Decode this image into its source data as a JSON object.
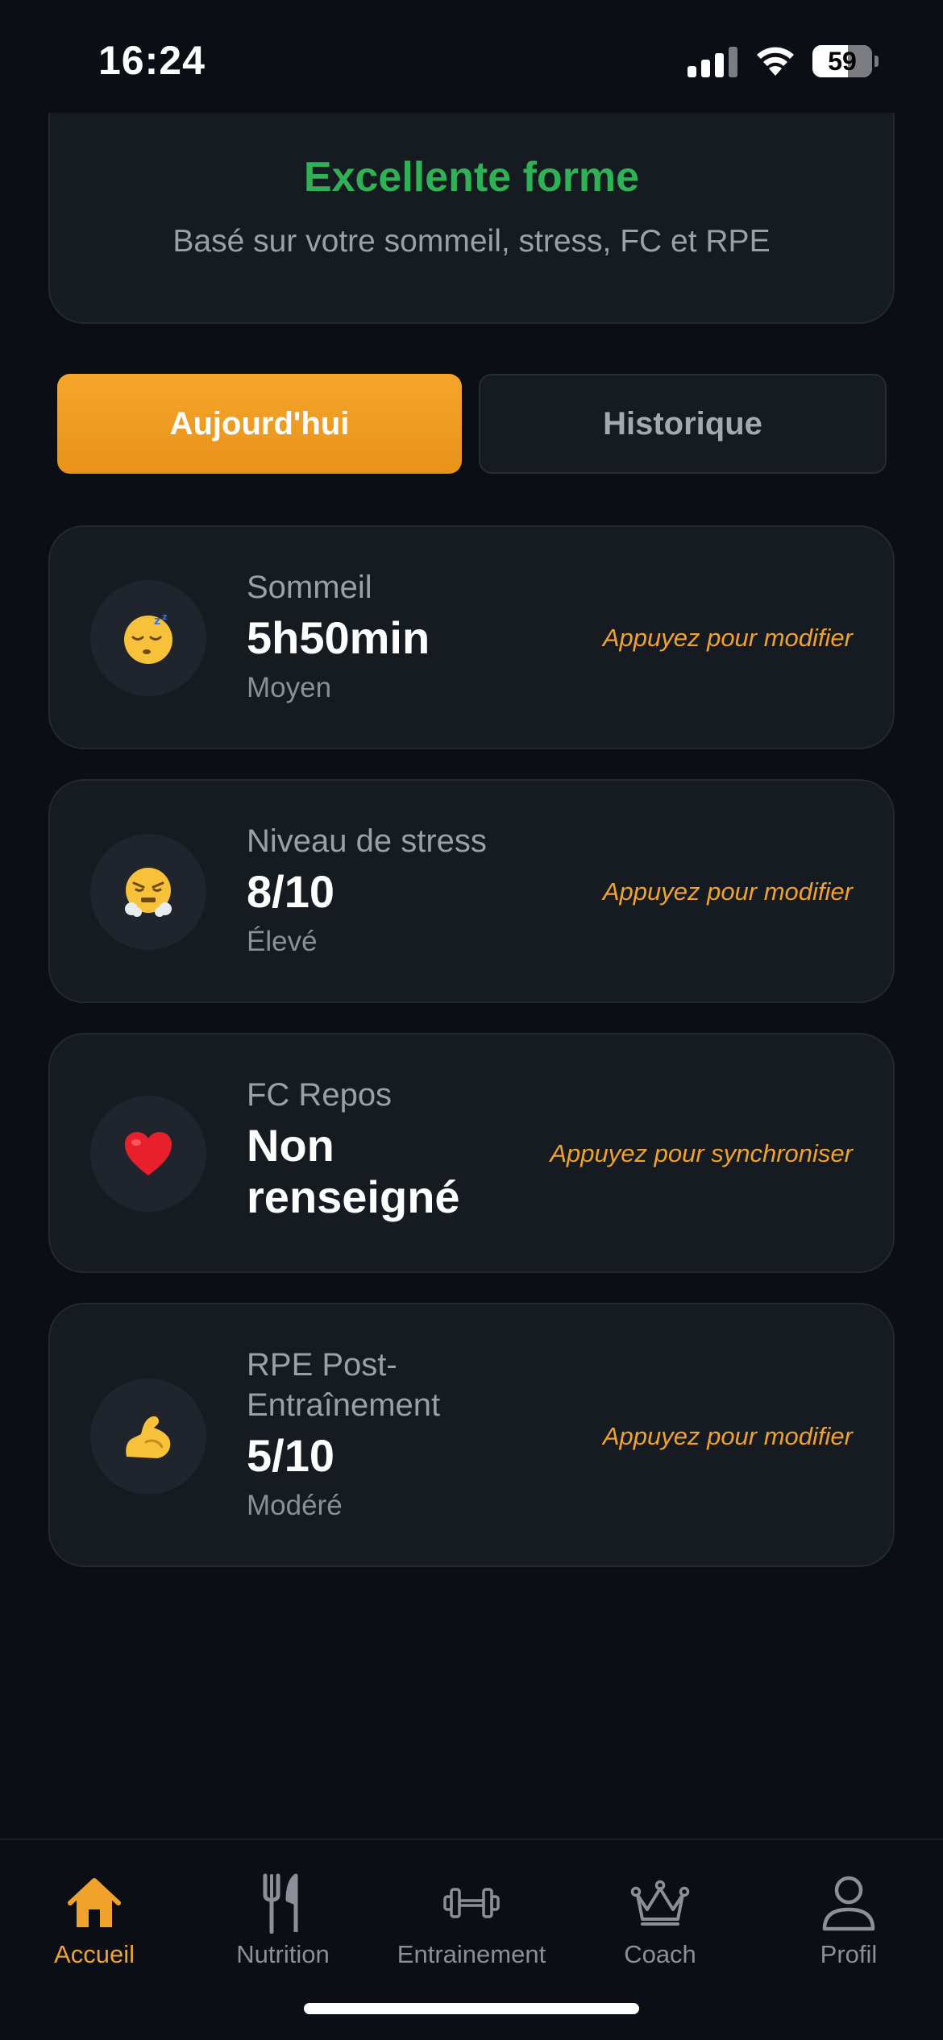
{
  "status_bar": {
    "time": "16:24",
    "battery": "59"
  },
  "readiness": {
    "title": "Excellente forme",
    "subtitle": "Basé sur votre sommeil, stress, FC et RPE",
    "title_color": "#2fb155"
  },
  "tabs": [
    {
      "label": "Aujourd'hui",
      "active": true
    },
    {
      "label": "Historique",
      "active": false
    }
  ],
  "metrics": [
    {
      "label": "Sommeil",
      "value": "5h50min",
      "status": "Moyen",
      "action": "Appuyez pour modifier",
      "icon": "sleeping-face-emoji"
    },
    {
      "label": "Niveau de stress",
      "value": "8/10",
      "status": "Élevé",
      "action": "Appuyez pour modifier",
      "icon": "steaming-face-emoji"
    },
    {
      "label": "FC Repos",
      "value_line1": "Non",
      "value_line2": "renseigné",
      "action": "Appuyez pour synchroniser",
      "icon": "red-heart-emoji"
    },
    {
      "label_line1": "RPE Post-",
      "label_line2": "Entraînement",
      "value": "5/10",
      "status": "Modéré",
      "action": "Appuyez pour modifier",
      "icon": "flexed-biceps-emoji"
    }
  ],
  "nav": [
    {
      "label": "Accueil",
      "icon": "home-icon",
      "active": true
    },
    {
      "label": "Nutrition",
      "icon": "fork-knife-icon",
      "active": false
    },
    {
      "label": "Entrainement",
      "icon": "dumbbell-icon",
      "active": false
    },
    {
      "label": "Coach",
      "icon": "crown-icon",
      "active": false
    },
    {
      "label": "Profil",
      "icon": "person-icon",
      "active": false
    }
  ],
  "colors": {
    "accent": "#f0a22b",
    "background": "#0b0e14",
    "card": "#161a21"
  }
}
